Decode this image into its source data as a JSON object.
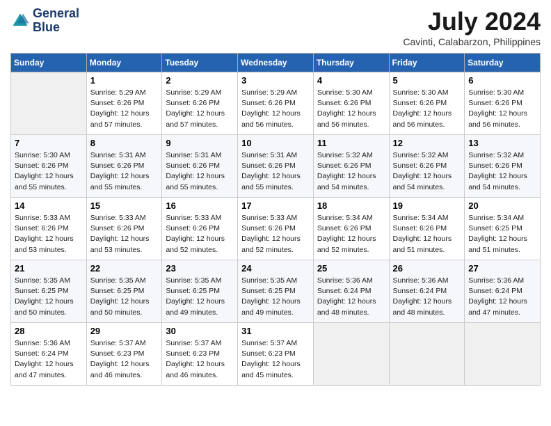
{
  "logo": {
    "line1": "General",
    "line2": "Blue"
  },
  "title": "July 2024",
  "location": "Cavinti, Calabarzon, Philippines",
  "days_header": [
    "Sunday",
    "Monday",
    "Tuesday",
    "Wednesday",
    "Thursday",
    "Friday",
    "Saturday"
  ],
  "weeks": [
    [
      {
        "num": "",
        "info": ""
      },
      {
        "num": "1",
        "info": "Sunrise: 5:29 AM\nSunset: 6:26 PM\nDaylight: 12 hours\nand 57 minutes."
      },
      {
        "num": "2",
        "info": "Sunrise: 5:29 AM\nSunset: 6:26 PM\nDaylight: 12 hours\nand 57 minutes."
      },
      {
        "num": "3",
        "info": "Sunrise: 5:29 AM\nSunset: 6:26 PM\nDaylight: 12 hours\nand 56 minutes."
      },
      {
        "num": "4",
        "info": "Sunrise: 5:30 AM\nSunset: 6:26 PM\nDaylight: 12 hours\nand 56 minutes."
      },
      {
        "num": "5",
        "info": "Sunrise: 5:30 AM\nSunset: 6:26 PM\nDaylight: 12 hours\nand 56 minutes."
      },
      {
        "num": "6",
        "info": "Sunrise: 5:30 AM\nSunset: 6:26 PM\nDaylight: 12 hours\nand 56 minutes."
      }
    ],
    [
      {
        "num": "7",
        "info": "Sunrise: 5:30 AM\nSunset: 6:26 PM\nDaylight: 12 hours\nand 55 minutes."
      },
      {
        "num": "8",
        "info": "Sunrise: 5:31 AM\nSunset: 6:26 PM\nDaylight: 12 hours\nand 55 minutes."
      },
      {
        "num": "9",
        "info": "Sunrise: 5:31 AM\nSunset: 6:26 PM\nDaylight: 12 hours\nand 55 minutes."
      },
      {
        "num": "10",
        "info": "Sunrise: 5:31 AM\nSunset: 6:26 PM\nDaylight: 12 hours\nand 55 minutes."
      },
      {
        "num": "11",
        "info": "Sunrise: 5:32 AM\nSunset: 6:26 PM\nDaylight: 12 hours\nand 54 minutes."
      },
      {
        "num": "12",
        "info": "Sunrise: 5:32 AM\nSunset: 6:26 PM\nDaylight: 12 hours\nand 54 minutes."
      },
      {
        "num": "13",
        "info": "Sunrise: 5:32 AM\nSunset: 6:26 PM\nDaylight: 12 hours\nand 54 minutes."
      }
    ],
    [
      {
        "num": "14",
        "info": "Sunrise: 5:33 AM\nSunset: 6:26 PM\nDaylight: 12 hours\nand 53 minutes."
      },
      {
        "num": "15",
        "info": "Sunrise: 5:33 AM\nSunset: 6:26 PM\nDaylight: 12 hours\nand 53 minutes."
      },
      {
        "num": "16",
        "info": "Sunrise: 5:33 AM\nSunset: 6:26 PM\nDaylight: 12 hours\nand 52 minutes."
      },
      {
        "num": "17",
        "info": "Sunrise: 5:33 AM\nSunset: 6:26 PM\nDaylight: 12 hours\nand 52 minutes."
      },
      {
        "num": "18",
        "info": "Sunrise: 5:34 AM\nSunset: 6:26 PM\nDaylight: 12 hours\nand 52 minutes."
      },
      {
        "num": "19",
        "info": "Sunrise: 5:34 AM\nSunset: 6:26 PM\nDaylight: 12 hours\nand 51 minutes."
      },
      {
        "num": "20",
        "info": "Sunrise: 5:34 AM\nSunset: 6:25 PM\nDaylight: 12 hours\nand 51 minutes."
      }
    ],
    [
      {
        "num": "21",
        "info": "Sunrise: 5:35 AM\nSunset: 6:25 PM\nDaylight: 12 hours\nand 50 minutes."
      },
      {
        "num": "22",
        "info": "Sunrise: 5:35 AM\nSunset: 6:25 PM\nDaylight: 12 hours\nand 50 minutes."
      },
      {
        "num": "23",
        "info": "Sunrise: 5:35 AM\nSunset: 6:25 PM\nDaylight: 12 hours\nand 49 minutes."
      },
      {
        "num": "24",
        "info": "Sunrise: 5:35 AM\nSunset: 6:25 PM\nDaylight: 12 hours\nand 49 minutes."
      },
      {
        "num": "25",
        "info": "Sunrise: 5:36 AM\nSunset: 6:24 PM\nDaylight: 12 hours\nand 48 minutes."
      },
      {
        "num": "26",
        "info": "Sunrise: 5:36 AM\nSunset: 6:24 PM\nDaylight: 12 hours\nand 48 minutes."
      },
      {
        "num": "27",
        "info": "Sunrise: 5:36 AM\nSunset: 6:24 PM\nDaylight: 12 hours\nand 47 minutes."
      }
    ],
    [
      {
        "num": "28",
        "info": "Sunrise: 5:36 AM\nSunset: 6:24 PM\nDaylight: 12 hours\nand 47 minutes."
      },
      {
        "num": "29",
        "info": "Sunrise: 5:37 AM\nSunset: 6:23 PM\nDaylight: 12 hours\nand 46 minutes."
      },
      {
        "num": "30",
        "info": "Sunrise: 5:37 AM\nSunset: 6:23 PM\nDaylight: 12 hours\nand 46 minutes."
      },
      {
        "num": "31",
        "info": "Sunrise: 5:37 AM\nSunset: 6:23 PM\nDaylight: 12 hours\nand 45 minutes."
      },
      {
        "num": "",
        "info": ""
      },
      {
        "num": "",
        "info": ""
      },
      {
        "num": "",
        "info": ""
      }
    ]
  ]
}
